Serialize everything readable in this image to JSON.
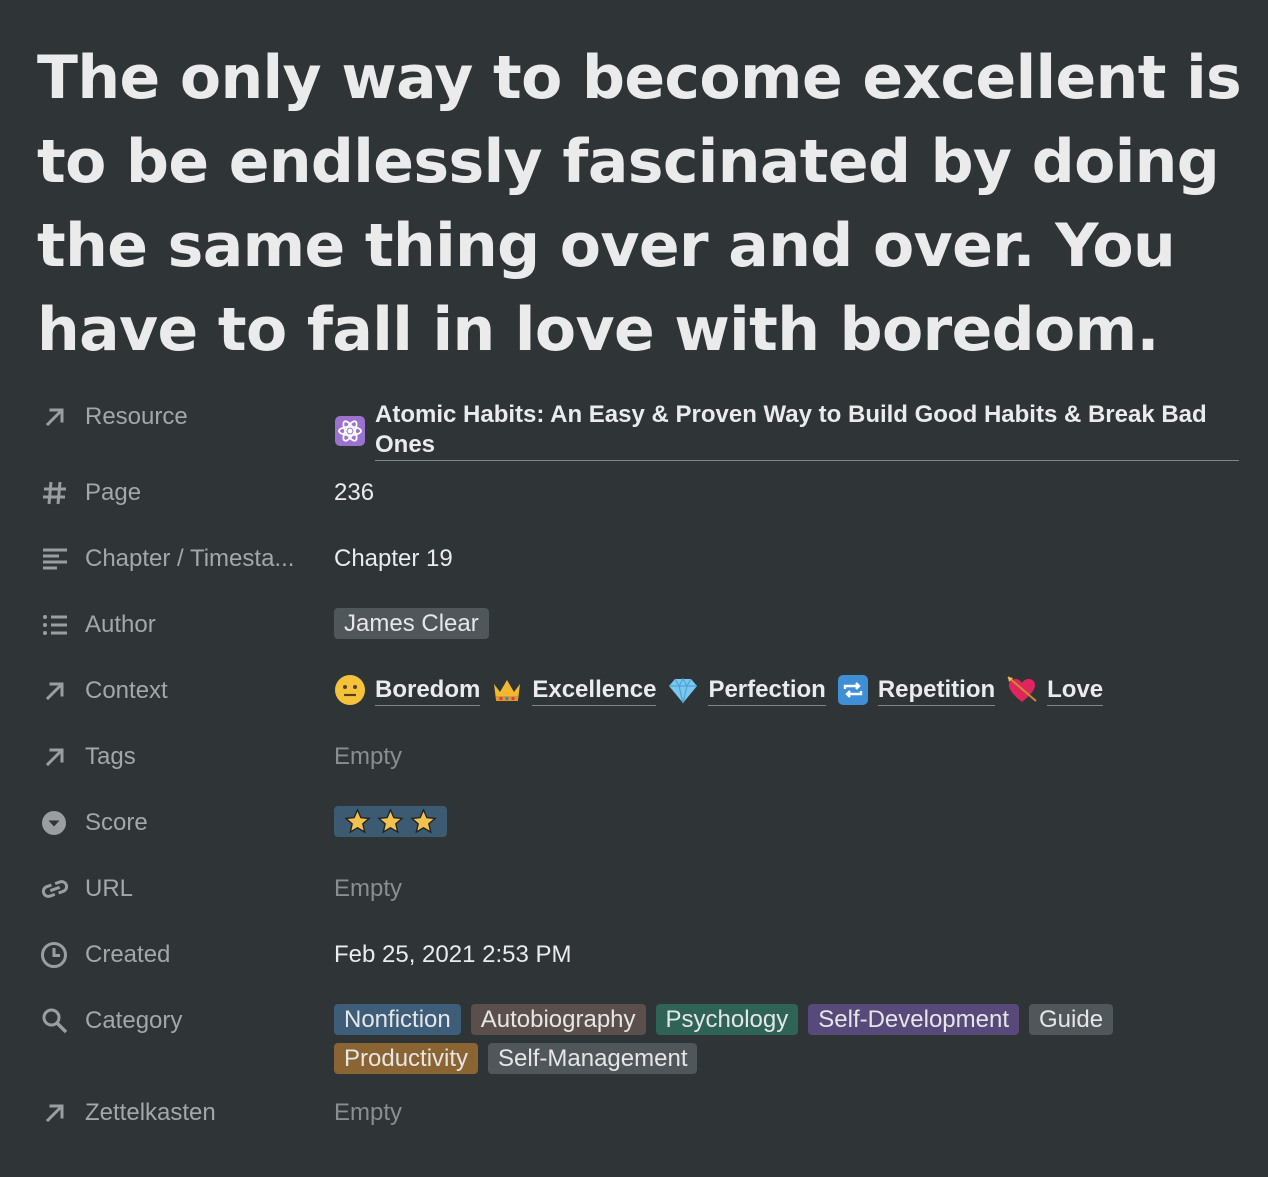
{
  "title": "The only way to become excellent is to be endlessly fascinated by doing the same thing over and over. You have to fall in love with boredom.",
  "properties": {
    "resource": {
      "label": "Resource",
      "icon": "arrow-up-right-icon",
      "link": {
        "icon": "atom-emoji",
        "text": "Atomic Habits: An Easy & Proven Way to Build Good Habits & Break Bad Ones"
      }
    },
    "page": {
      "label": "Page",
      "icon": "hash-icon",
      "value": "236"
    },
    "chapter": {
      "label": "Chapter / Timesta...",
      "icon": "text-lines-icon",
      "value": "Chapter 19"
    },
    "author": {
      "label": "Author",
      "icon": "list-icon",
      "tag": {
        "text": "James Clear",
        "color": "#50575b"
      }
    },
    "context": {
      "label": "Context",
      "icon": "arrow-up-right-icon",
      "links": [
        {
          "icon": "neutral-face-emoji",
          "text": "Boredom"
        },
        {
          "icon": "crown-emoji",
          "text": "Excellence"
        },
        {
          "icon": "gem-emoji",
          "text": "Perfection"
        },
        {
          "icon": "repeat-emoji",
          "text": "Repetition"
        },
        {
          "icon": "heart-arrow-emoji",
          "text": "Love"
        }
      ]
    },
    "tags": {
      "label": "Tags",
      "icon": "arrow-up-right-icon",
      "value": "Empty"
    },
    "score": {
      "label": "Score",
      "icon": "select-icon",
      "stars": 3,
      "color": "#3c5a72"
    },
    "url": {
      "label": "URL",
      "icon": "link-icon",
      "value": "Empty"
    },
    "created": {
      "label": "Created",
      "icon": "clock-icon",
      "value": "Feb 25, 2021 2:53 PM"
    },
    "category": {
      "label": "Category",
      "icon": "search-icon",
      "tags": [
        {
          "text": "Nonfiction",
          "color": "#3d5d78"
        },
        {
          "text": "Autobiography",
          "color": "#5b4f4c"
        },
        {
          "text": "Psychology",
          "color": "#2f6356"
        },
        {
          "text": "Self-Development",
          "color": "#57497a"
        },
        {
          "text": "Guide",
          "color": "#50575b"
        },
        {
          "text": "Productivity",
          "color": "#8a6432"
        },
        {
          "text": "Self-Management",
          "color": "#50575b"
        }
      ]
    },
    "zettelkasten": {
      "label": "Zettelkasten",
      "icon": "arrow-up-right-icon",
      "value": "Empty"
    }
  }
}
